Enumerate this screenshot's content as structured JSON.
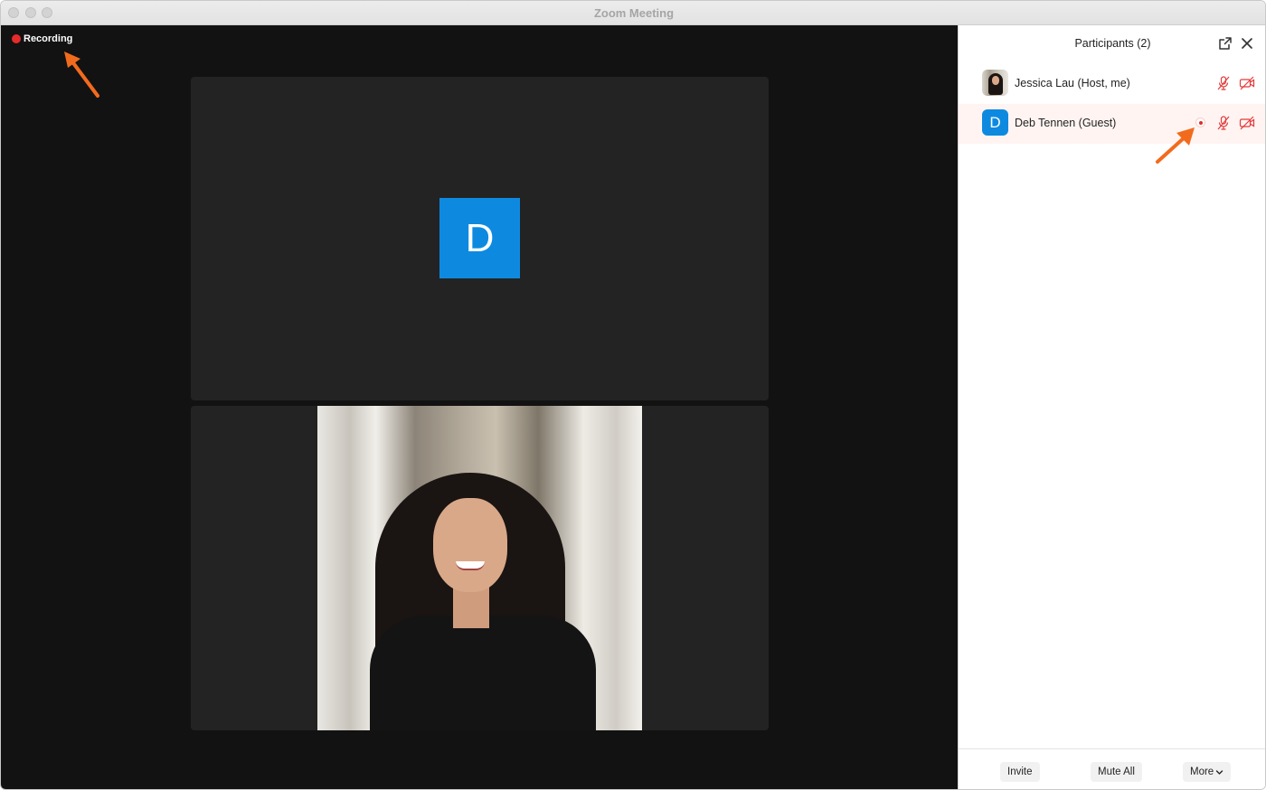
{
  "window": {
    "title": "Zoom Meeting"
  },
  "meeting": {
    "recording_label": "Recording",
    "tiles": [
      {
        "type": "avatar",
        "initial": "D"
      },
      {
        "type": "video"
      }
    ]
  },
  "participants_panel": {
    "title": "Participants (2)",
    "participants": [
      {
        "name": "Jessica Lau (Host, me)",
        "avatar": "photo",
        "mic": "muted",
        "video": "off"
      },
      {
        "name": "Deb Tennen (Guest)",
        "avatar_initial": "D",
        "recording": true,
        "mic": "muted",
        "video": "off"
      }
    ],
    "footer": {
      "invite_label": "Invite",
      "mute_all_label": "Mute All",
      "more_label": "More"
    }
  },
  "colors": {
    "recording_red": "#e52b2b",
    "avatar_blue": "#0d8ae0",
    "annotation_orange": "#f26b1d",
    "muted_red": "#e23b3b"
  },
  "icons": [
    "popout-icon",
    "close-icon",
    "mic-muted-icon",
    "video-off-icon",
    "chevron-down-icon"
  ]
}
